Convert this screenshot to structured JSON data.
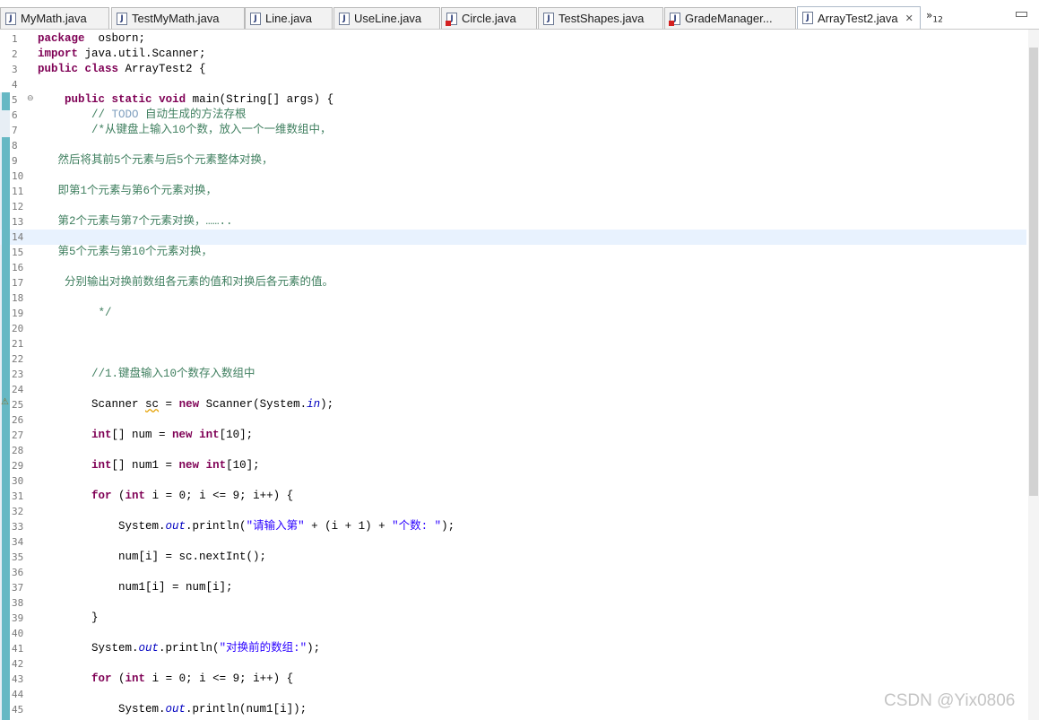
{
  "tabs": [
    {
      "label": "MyMath.java",
      "icon": "java-file-icon",
      "error": false
    },
    {
      "label": "TestMyMath.java",
      "icon": "java-file-icon",
      "error": false
    },
    {
      "label": "Line.java",
      "icon": "java-file-icon",
      "error": false
    },
    {
      "label": "UseLine.java",
      "icon": "java-file-icon",
      "error": false
    },
    {
      "label": "Circle.java",
      "icon": "java-file-error-icon",
      "error": true
    },
    {
      "label": "TestShapes.java",
      "icon": "java-file-icon",
      "error": false
    },
    {
      "label": "GradeManager...",
      "icon": "java-file-error-icon",
      "error": true
    },
    {
      "label": "ArrayTest2.java",
      "icon": "java-file-icon",
      "error": false,
      "active": true,
      "close": "✕"
    }
  ],
  "overflow": {
    "symbol": "»",
    "count": "12"
  },
  "editor": {
    "lines": [
      {
        "n": "1",
        "segs": [
          [
            "kw",
            "package"
          ],
          [
            "",
            "  osborn;"
          ]
        ]
      },
      {
        "n": "2",
        "segs": [
          [
            "kw",
            "import"
          ],
          [
            "",
            " java.util.Scanner;"
          ]
        ]
      },
      {
        "n": "3",
        "segs": [
          [
            "kw",
            "public"
          ],
          [
            "",
            " "
          ],
          [
            "kw",
            "class"
          ],
          [
            "",
            " ArrayTest2 {"
          ]
        ]
      },
      {
        "n": "4",
        "segs": []
      },
      {
        "n": "5",
        "segs": [
          [
            "",
            "    "
          ],
          [
            "kw",
            "public"
          ],
          [
            "",
            " "
          ],
          [
            "kw",
            "static"
          ],
          [
            "",
            " "
          ],
          [
            "kw",
            "void"
          ],
          [
            "",
            " main(String[] args) {"
          ]
        ]
      },
      {
        "n": "6",
        "segs": [
          [
            "",
            "        "
          ],
          [
            "cm",
            "// "
          ],
          [
            "todo",
            "TODO"
          ],
          [
            "cm",
            " 自动生成的方法存根"
          ]
        ]
      },
      {
        "n": "7",
        "segs": [
          [
            "",
            "        "
          ],
          [
            "cm",
            "/*从键盘上输入10个数，放入一个一维数组中，"
          ]
        ]
      },
      {
        "n": "8",
        "segs": []
      },
      {
        "n": "9",
        "segs": [
          [
            "",
            "   "
          ],
          [
            "cm",
            "然后将其前5个元素与后5个元素整体对换，"
          ]
        ]
      },
      {
        "n": "10",
        "segs": []
      },
      {
        "n": "11",
        "segs": [
          [
            "",
            "   "
          ],
          [
            "cm",
            "即第1个元素与第6个元素对换，"
          ]
        ]
      },
      {
        "n": "12",
        "segs": []
      },
      {
        "n": "13",
        "segs": [
          [
            "",
            "   "
          ],
          [
            "cm",
            "第2个元素与第7个元素对换，…….."
          ]
        ]
      },
      {
        "n": "14",
        "segs": []
      },
      {
        "n": "15",
        "segs": [
          [
            "",
            "   "
          ],
          [
            "cm",
            "第5个元素与第10个元素对换，"
          ]
        ]
      },
      {
        "n": "16",
        "segs": []
      },
      {
        "n": "17",
        "segs": [
          [
            "",
            "   "
          ],
          [
            "cm",
            " 分别输出对换前数组各元素的值和对换后各元素的值。"
          ]
        ]
      },
      {
        "n": "18",
        "segs": []
      },
      {
        "n": "19",
        "segs": [
          [
            "",
            "         "
          ],
          [
            "cm",
            "*/"
          ]
        ]
      },
      {
        "n": "20",
        "segs": []
      },
      {
        "n": "21",
        "segs": []
      },
      {
        "n": "22",
        "segs": []
      },
      {
        "n": "23",
        "segs": [
          [
            "",
            "        "
          ],
          [
            "cm",
            "//1.键盘输入10个数存入数组中"
          ]
        ]
      },
      {
        "n": "24",
        "segs": []
      },
      {
        "n": "25",
        "segs": [
          [
            "",
            "        Scanner "
          ],
          [
            "warn",
            "sc"
          ],
          [
            "",
            " = "
          ],
          [
            "kw",
            "new"
          ],
          [
            "",
            " Scanner(System."
          ],
          [
            "fld",
            "in"
          ],
          [
            "",
            ");"
          ]
        ]
      },
      {
        "n": "26",
        "segs": []
      },
      {
        "n": "27",
        "segs": [
          [
            "",
            "        "
          ],
          [
            "kw",
            "int"
          ],
          [
            "",
            "[] num = "
          ],
          [
            "kw",
            "new"
          ],
          [
            "",
            " "
          ],
          [
            "kw",
            "int"
          ],
          [
            "",
            "[10];"
          ]
        ]
      },
      {
        "n": "28",
        "segs": []
      },
      {
        "n": "29",
        "segs": [
          [
            "",
            "        "
          ],
          [
            "kw",
            "int"
          ],
          [
            "",
            "[] num1 = "
          ],
          [
            "kw",
            "new"
          ],
          [
            "",
            " "
          ],
          [
            "kw",
            "int"
          ],
          [
            "",
            "[10];"
          ]
        ]
      },
      {
        "n": "30",
        "segs": []
      },
      {
        "n": "31",
        "segs": [
          [
            "",
            "        "
          ],
          [
            "kw",
            "for"
          ],
          [
            "",
            " ("
          ],
          [
            "kw",
            "int"
          ],
          [
            "",
            " i = 0; i <= 9; i++) {"
          ]
        ]
      },
      {
        "n": "32",
        "segs": []
      },
      {
        "n": "33",
        "segs": [
          [
            "",
            "            System."
          ],
          [
            "fld",
            "out"
          ],
          [
            "",
            ".println("
          ],
          [
            "str",
            "\"请输入第\""
          ],
          [
            "",
            " + (i + 1) + "
          ],
          [
            "str",
            "\"个数: \""
          ],
          [
            "",
            ");"
          ]
        ]
      },
      {
        "n": "34",
        "segs": []
      },
      {
        "n": "35",
        "segs": [
          [
            "",
            "            num[i] = sc.nextInt();"
          ]
        ]
      },
      {
        "n": "36",
        "segs": []
      },
      {
        "n": "37",
        "segs": [
          [
            "",
            "            num1[i] = num[i];"
          ]
        ]
      },
      {
        "n": "38",
        "segs": []
      },
      {
        "n": "39",
        "segs": [
          [
            "",
            "        }"
          ]
        ]
      },
      {
        "n": "40",
        "segs": []
      },
      {
        "n": "41",
        "segs": [
          [
            "",
            "        System."
          ],
          [
            "fld",
            "out"
          ],
          [
            "",
            ".println("
          ],
          [
            "str",
            "\"对换前的数组:\""
          ],
          [
            "",
            ");"
          ]
        ]
      },
      {
        "n": "42",
        "segs": []
      },
      {
        "n": "43",
        "segs": [
          [
            "",
            "        "
          ],
          [
            "kw",
            "for"
          ],
          [
            "",
            " ("
          ],
          [
            "kw",
            "int"
          ],
          [
            "",
            " i = 0; i <= 9; i++) {"
          ]
        ]
      },
      {
        "n": "44",
        "segs": []
      },
      {
        "n": "45",
        "segs": [
          [
            "",
            "            System."
          ],
          [
            "fld",
            "out"
          ],
          [
            "",
            ".println(num1[i]);"
          ]
        ]
      }
    ],
    "current_line": "14",
    "fold_marker": "⊖"
  },
  "watermark": "CSDN @Yix0806"
}
